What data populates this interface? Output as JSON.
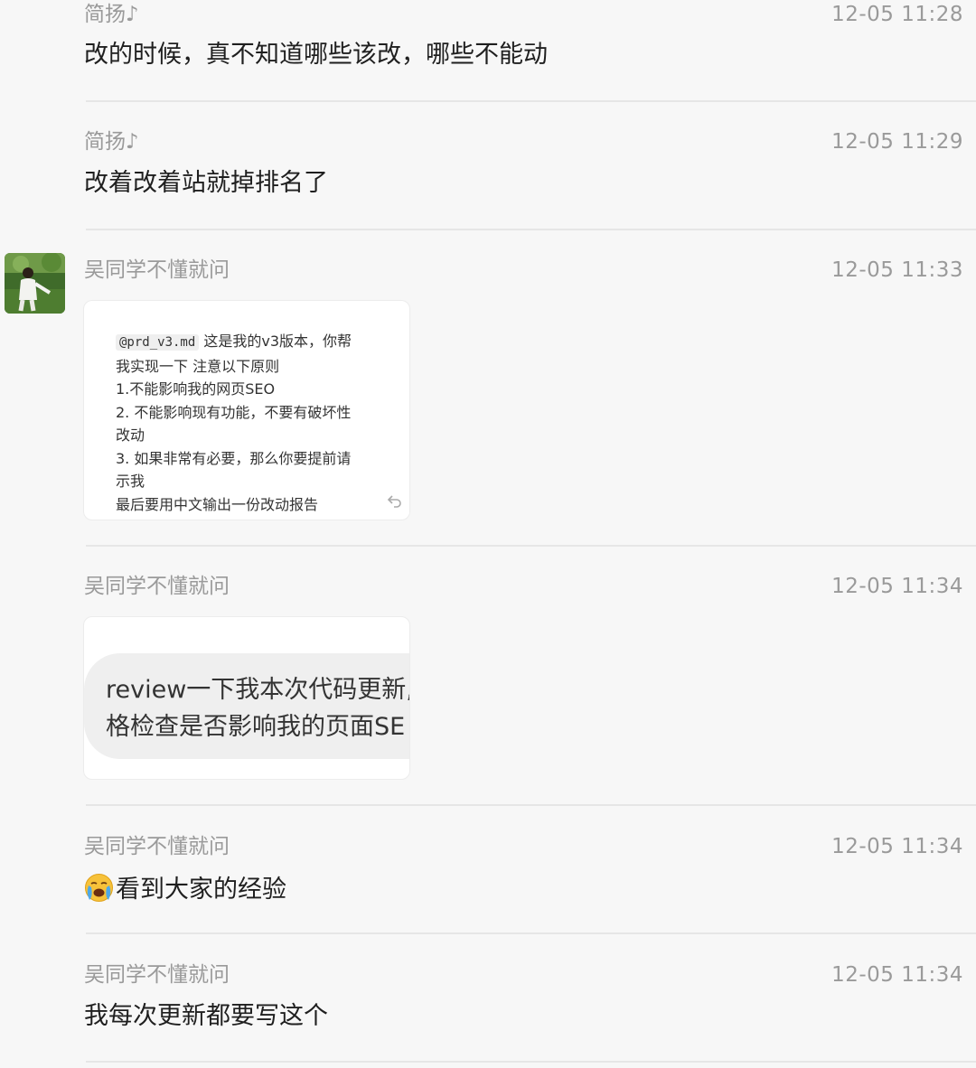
{
  "messages": [
    {
      "sender": "简扬♪",
      "time": "12-05 11:28",
      "text": "改的时候，真不知道哪些该改，哪些不能动"
    },
    {
      "sender": "简扬♪",
      "time": "12-05 11:29",
      "text": "改着改着站就掉排名了"
    },
    {
      "sender": "吴同学不懂就问",
      "time": "12-05 11:33",
      "image": {
        "code_tag": "@prd_v3.md",
        "line1_rest": "这是我的v3版本，你帮",
        "lines": [
          "我实现一下  注意以下原则",
          "1.不能影响我的网页SEO",
          "2. 不能影响现有功能，不要有破坏性",
          "改动",
          "3. 如果非常有必要，那么你要提前请",
          "示我",
          "最后要用中文输出一份改动报告"
        ]
      }
    },
    {
      "sender": "吴同学不懂就问",
      "time": "12-05 11:34",
      "image": {
        "lines": [
          "review一下我本次代码更新,",
          "格检查是否影响我的页面SE"
        ]
      }
    },
    {
      "sender": "吴同学不懂就问",
      "time": "12-05 11:34",
      "emoji": "crying-face-emoji",
      "text": "看到大家的经验"
    },
    {
      "sender": "吴同学不懂就问",
      "time": "12-05 11:34",
      "text": "我每次更新都要写这个"
    }
  ],
  "colors": {
    "background": "#f7f7f7",
    "meta": "#9a9a9a",
    "text": "#1f1f1f",
    "divider": "#e6e6e6"
  }
}
